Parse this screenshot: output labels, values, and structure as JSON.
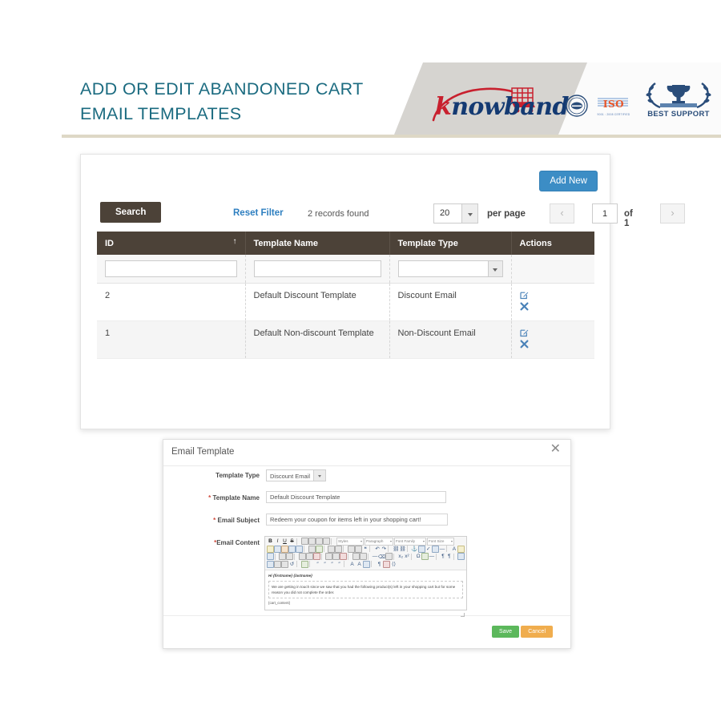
{
  "header": {
    "title": "ADD OR EDIT ABANDONED CART EMAIL TEMPLATES",
    "brand_k": "k",
    "brand_rest": "nowband",
    "badge_iso": "ISO",
    "badge_iso_sub": "9001 : 2008 CERTIFIED",
    "badge_support": "BEST SUPPORT",
    "title_color": "#1b6b80"
  },
  "grid": {
    "add_new_label": "Add New",
    "search_label": "Search",
    "reset_filter_label": "Reset Filter",
    "records_found": "2 records found",
    "per_page_value": "20",
    "per_page_label": "per page",
    "prev_glyph": "‹",
    "next_glyph": "›",
    "page_value": "1",
    "page_of": "of 1",
    "sort_arrow": "↑",
    "columns": [
      "ID",
      "Template Name",
      "Template Type",
      "Actions"
    ],
    "filters": {
      "id": "",
      "template_name": "",
      "template_type": ""
    },
    "rows": [
      {
        "id": "2",
        "name": "Default Discount Template",
        "type": "Discount Email"
      },
      {
        "id": "1",
        "name": "Default Non-discount Template",
        "type": "Non-Discount Email"
      }
    ],
    "action_icons": [
      "edit-icon",
      "delete-icon"
    ],
    "accent_blue": "#3c8dc5",
    "header_brown": "#4c4238"
  },
  "modal": {
    "title": "Email Template",
    "close_glyph": "✕",
    "fields": {
      "template_type_label": "Template Type",
      "template_type_value": "Discount Email",
      "template_name_label": "Template Name",
      "template_name_value": "Default Discount Template",
      "email_subject_label": "Email Subject",
      "email_subject_value": "Redeem your coupon for items left in your shopping cart!",
      "email_content_label": "Email Content",
      "required_mark": "*"
    },
    "editor": {
      "dropdowns": [
        "Styles",
        "Paragraph",
        "Font Family",
        "Font Size"
      ],
      "format_buttons": [
        "B",
        "I",
        "U",
        "S"
      ],
      "greeting": "Hi {firstname} {lastname}",
      "paragraph": "We are getting in touch since we saw that you had the following product(s) left in your shopping cart but for some reason you did not complete the order.",
      "token": "{cart_content}"
    },
    "save_label": "Save",
    "cancel_label": "Cancel",
    "save_color": "#5cb85c",
    "cancel_color": "#f0ad4e"
  }
}
